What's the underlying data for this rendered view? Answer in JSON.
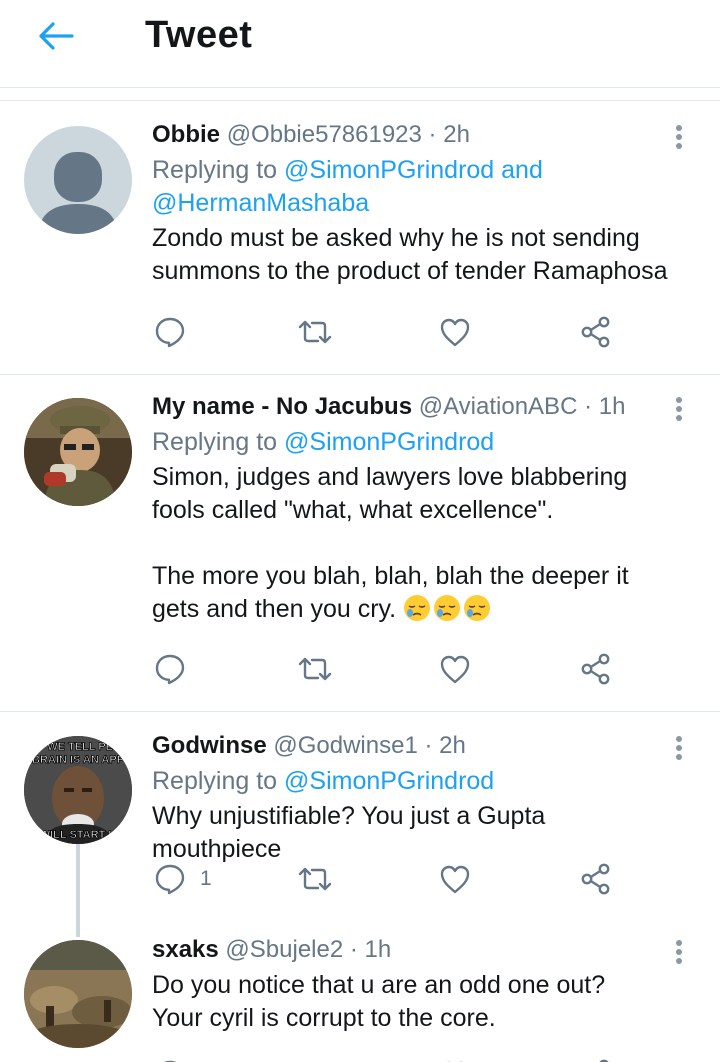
{
  "header": {
    "title": "Tweet",
    "back_icon": "back-arrow-icon"
  },
  "accent_color": "#1da1f2",
  "tweets": [
    {
      "name": "Obbie",
      "handle": "@Obbie57861923",
      "separator": "·",
      "time": "2h",
      "replying_prefix": "Replying to ",
      "replying_to": "@SimonPGrindrod and",
      "replying_to_2": "@HermanMashaba",
      "text": "Zondo must be asked why he is not sending summons to the product of tender Ramaphosa",
      "reply_count": ""
    },
    {
      "name": "My name - No Jacubus",
      "handle": "@AviationABC",
      "separator": "·",
      "time": "1h",
      "replying_prefix": "Replying to ",
      "replying_to": "@SimonPGrindrod",
      "text": "Simon, judges and lawyers love blabbering fools called \"what, what excellence\".\n\nThe more you blah, blah, blah the deeper it gets and then you cry.",
      "emojis": [
        "sleepy-face-emoji",
        "sleepy-face-emoji",
        "sleepy-face-emoji"
      ],
      "reply_count": ""
    },
    {
      "name": "Godwinse",
      "handle": "@Godwinse1",
      "separator": "·",
      "time": "2h",
      "replying_prefix": "Replying to ",
      "replying_to": "@SimonPGrindrod",
      "text": "Why unjustifiable? You just a Gupta mouthpiece",
      "avatar_text_top": "IF WE TELL PEO",
      "avatar_text_mid": "BRAIN IS AN APP",
      "avatar_text_bottom": "WILL START U",
      "reply_count": "1"
    },
    {
      "name": "sxaks",
      "handle": "@Sbujele2",
      "separator": "·",
      "time": "1h",
      "text": "Do you notice that u are an odd one out?\nYour cyril is corrupt to the core.",
      "reply_count": ""
    }
  ],
  "action_icons": [
    "reply-icon",
    "retweet-icon",
    "like-icon",
    "share-icon"
  ]
}
